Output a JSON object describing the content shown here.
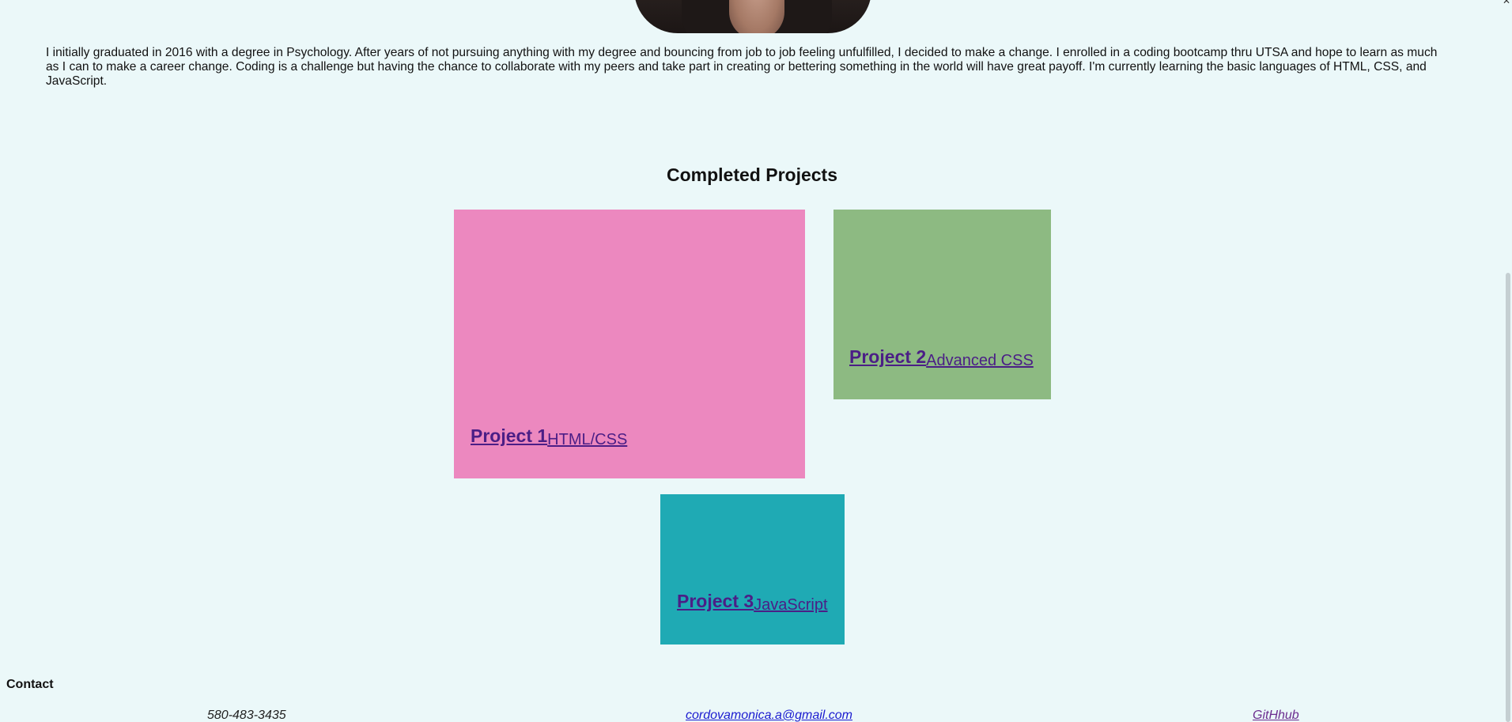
{
  "profile": {
    "bio": "I initially graduated in 2016 with a degree in Psychology. After years of not pursuing anything with my degree and bouncing from job to job feeling unfulfilled, I decided to make a change. I enrolled in a coding bootcamp thru UTSA and hope to learn as much as I can to make a career change. Coding is a challenge but having the chance to collaborate with my peers and take part in creating or bettering something in the world will have great payoff. I'm currently learning the basic languages of HTML, CSS, and JavaScript."
  },
  "projects": {
    "title": "Completed Projects",
    "items": [
      {
        "name": "Project 1",
        "tech": "HTML/CSS",
        "color": "#ec88bf"
      },
      {
        "name": "Project 2",
        "tech": "Advanced CSS",
        "color": "#8dba82"
      },
      {
        "name": "Project 3",
        "tech": "JavaScript",
        "color": "#1faab4"
      }
    ]
  },
  "contact": {
    "title": "Contact",
    "phone": "580-483-3435",
    "email": "cordovamonica.a@gmail.com",
    "github": "GitHhub"
  },
  "colors": {
    "background": "#ebf8f9",
    "link": "#4b1e86"
  }
}
